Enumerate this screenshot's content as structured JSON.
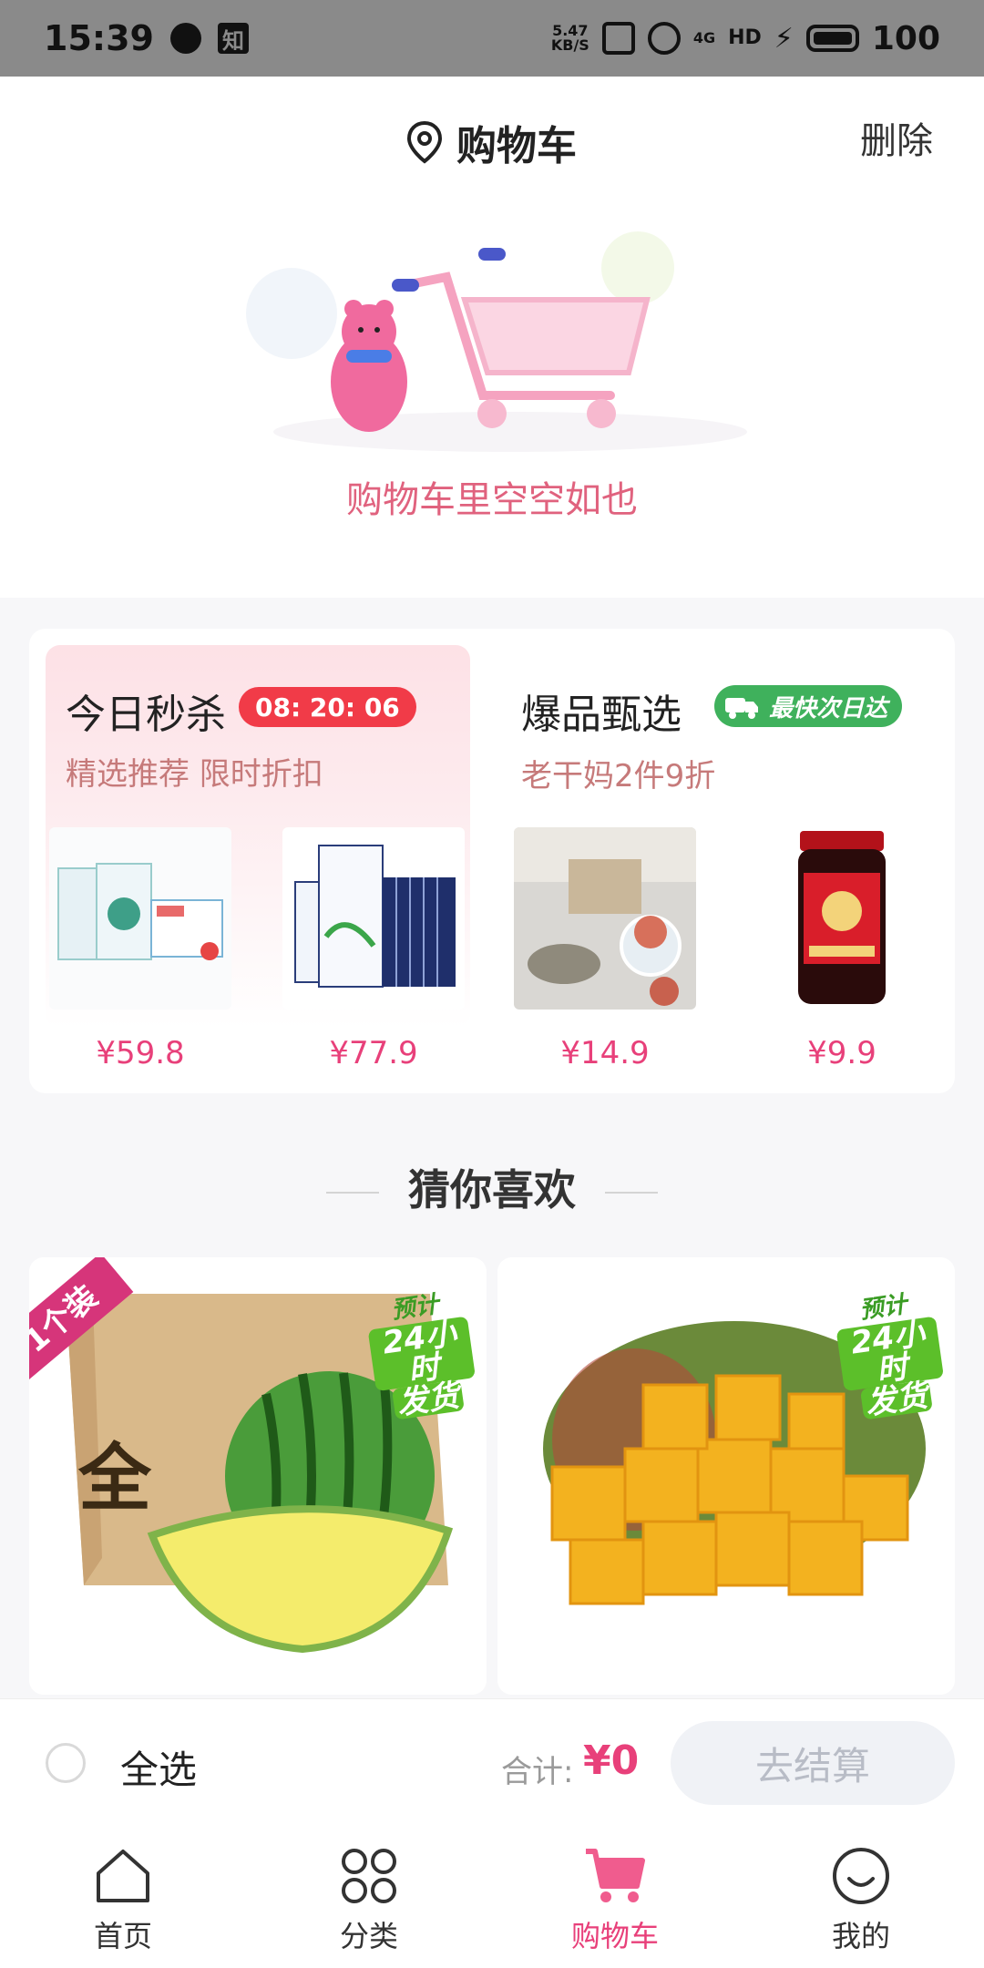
{
  "status_bar": {
    "time": "15:39",
    "zhi": "知",
    "net_speed_top": "5.47",
    "net_speed_bottom": "KB/S",
    "net_type": "4G",
    "hd": "HD",
    "battery": "100"
  },
  "header": {
    "title": "购物车",
    "delete_label": "删除"
  },
  "empty_cart": {
    "message": "购物车里空空如也"
  },
  "flash_sale": {
    "title": "今日秒杀",
    "countdown": "08: 20: 06",
    "subtitle": "精选推荐 限时折扣",
    "products": [
      {
        "price": "¥59.8"
      },
      {
        "price": "¥77.9"
      }
    ]
  },
  "hot_picks": {
    "title": "爆品甄选",
    "badge": "最快次日达",
    "subtitle": "老干妈2件9折",
    "products": [
      {
        "price": "¥14.9"
      },
      {
        "price": "¥9.9"
      }
    ]
  },
  "guess": {
    "title": "猜你喜欢",
    "cards": [
      {
        "ribbon": "1个装",
        "tag_line1": "预计",
        "tag_line2": "24小时",
        "tag_line3": "发货",
        "box_text": "全"
      },
      {
        "tag_line1": "预计",
        "tag_line2": "24小时",
        "tag_line3": "发货"
      }
    ]
  },
  "checkout": {
    "select_all": "全选",
    "total_label": "合计:",
    "total_value": "¥0",
    "button": "去结算"
  },
  "tabs": [
    {
      "label": "首页",
      "icon": "home-icon"
    },
    {
      "label": "分类",
      "icon": "grid-icon"
    },
    {
      "label": "购物车",
      "icon": "cart-icon"
    },
    {
      "label": "我的",
      "icon": "smile-icon"
    }
  ],
  "colors": {
    "accent": "#e8407a",
    "countdown_bg": "#f13b48",
    "badge_green": "#3fb15c"
  }
}
